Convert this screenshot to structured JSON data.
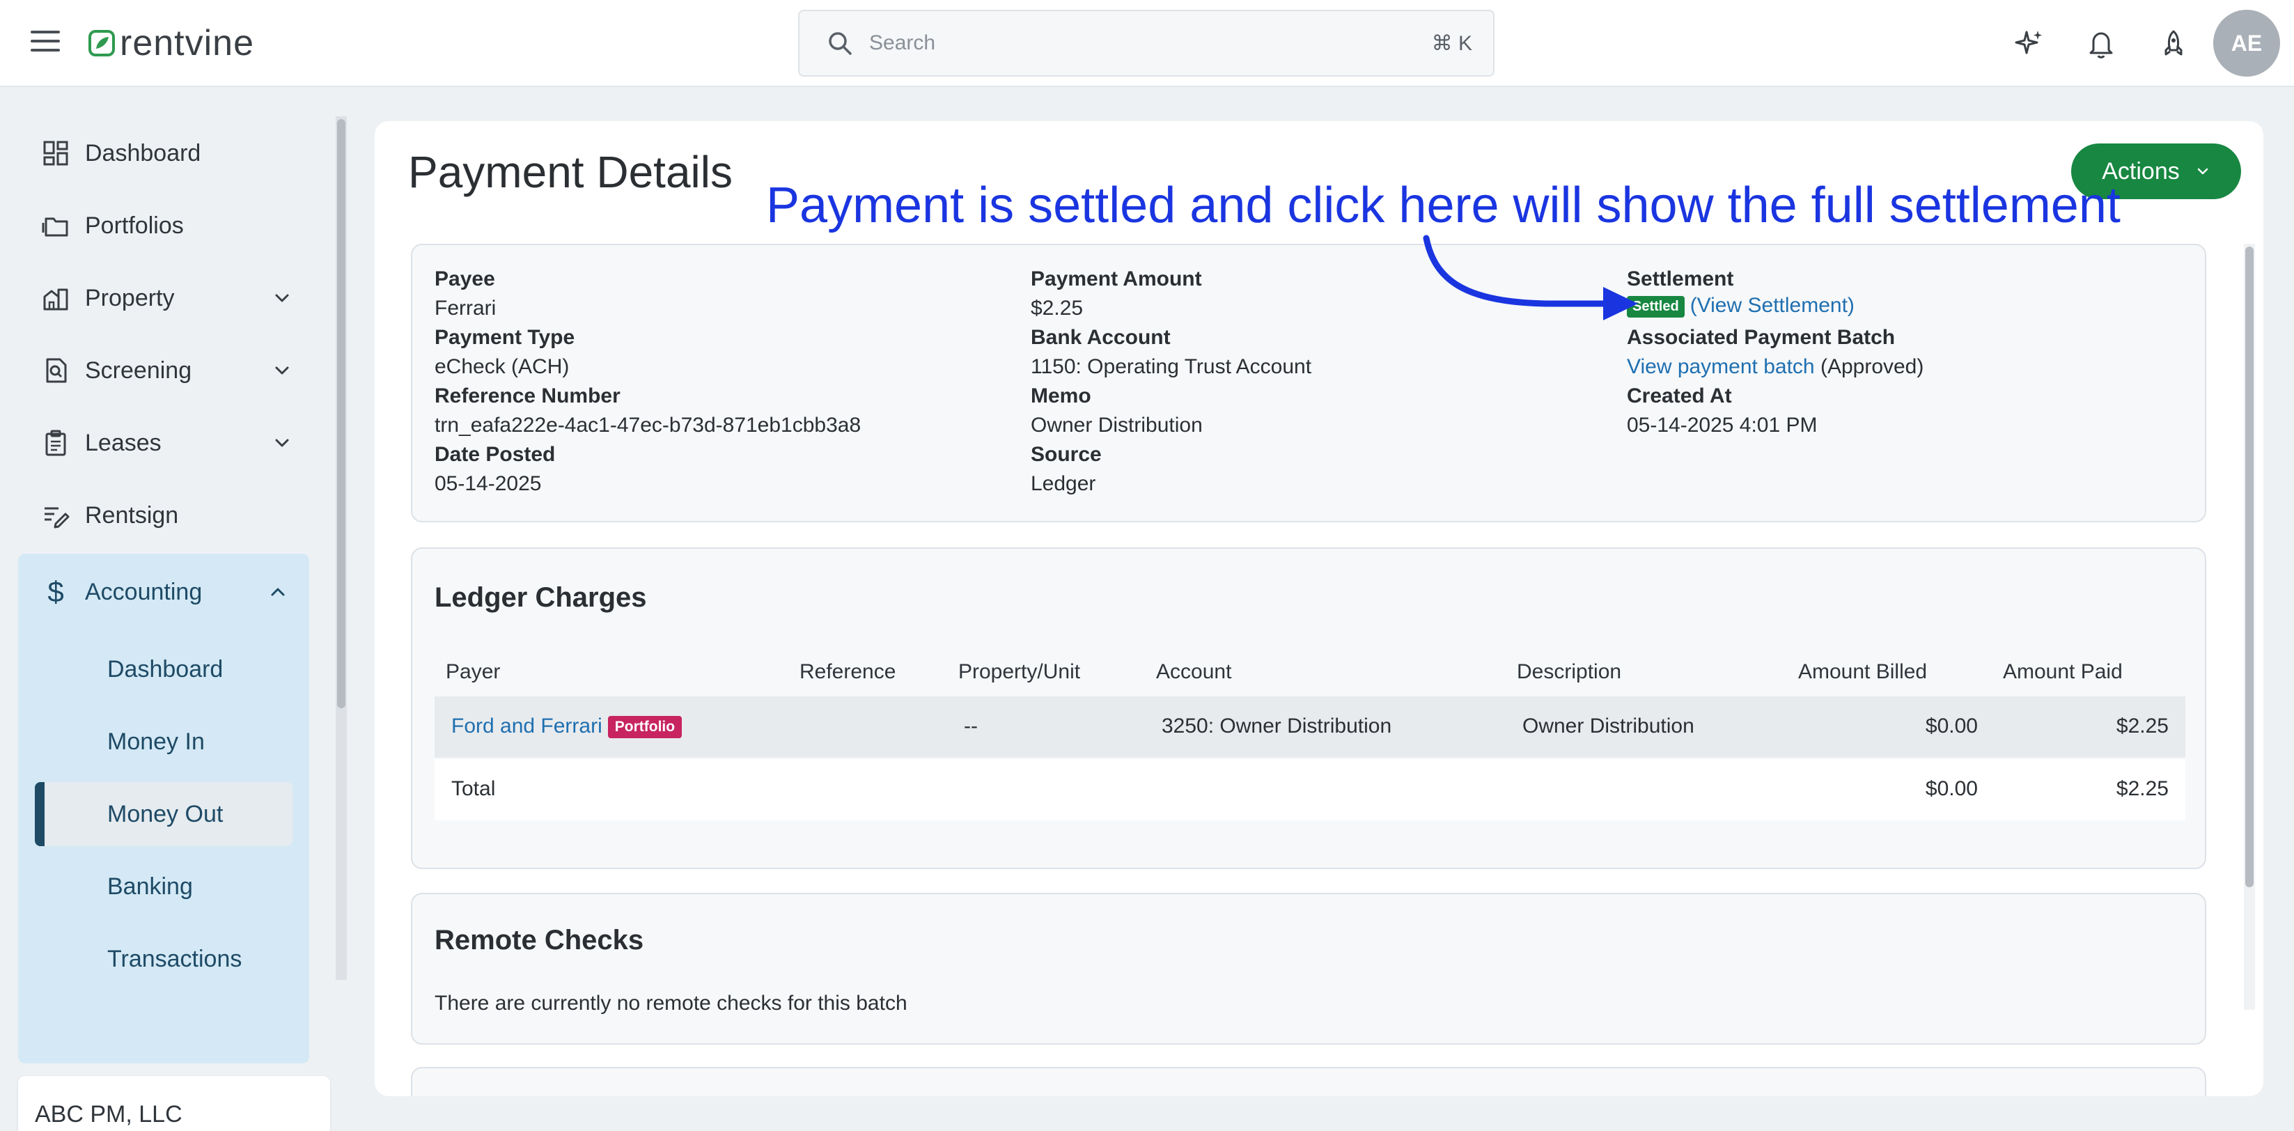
{
  "app": {
    "brand": "rentvine",
    "search_placeholder": "Search",
    "search_shortcut": "⌘ K",
    "avatar_initials": "AE",
    "accent_color": "#178741",
    "link_color": "#1f6fb0"
  },
  "sidebar": {
    "items": [
      {
        "label": "Dashboard",
        "icon": "dashboard-icon"
      },
      {
        "label": "Portfolios",
        "icon": "portfolios-icon"
      },
      {
        "label": "Property",
        "icon": "property-icon"
      },
      {
        "label": "Screening",
        "icon": "screening-icon"
      },
      {
        "label": "Leases",
        "icon": "leases-icon"
      },
      {
        "label": "Rentsign",
        "icon": "rentsign-icon"
      }
    ],
    "accounting": {
      "label": "Accounting",
      "children": [
        "Dashboard",
        "Money In",
        "Money Out",
        "Banking",
        "Transactions"
      ],
      "active": "Money Out"
    },
    "org_name": "ABC PM, LLC"
  },
  "page": {
    "title": "Payment Details",
    "actions_label": "Actions"
  },
  "details": {
    "payee_label": "Payee",
    "payee_value": "Ferrari",
    "payment_type_label": "Payment Type",
    "payment_type_value": "eCheck (ACH)",
    "reference_number_label": "Reference Number",
    "reference_number_value": "trn_eafa222e-4ac1-47ec-b73d-871eb1cbb3a8",
    "date_posted_label": "Date Posted",
    "date_posted_value": "05-14-2025",
    "payment_amount_label": "Payment Amount",
    "payment_amount_value": "$2.25",
    "bank_account_label": "Bank Account",
    "bank_account_value": "1150: Operating Trust Account",
    "memo_label": "Memo",
    "memo_value": "Owner Distribution",
    "source_label": "Source",
    "source_value": "Ledger",
    "settlement_label": "Settlement",
    "settlement_badge": "Settled",
    "settlement_link": "(View Settlement)",
    "batch_label": "Associated Payment Batch",
    "batch_link": "View payment batch",
    "batch_status": "(Approved)",
    "created_at_label": "Created At",
    "created_at_value": "05-14-2025 4:01 PM"
  },
  "ledger": {
    "title": "Ledger Charges",
    "columns": [
      "Payer",
      "Reference",
      "Property/Unit",
      "Account",
      "Description",
      "Amount Billed",
      "Amount Paid"
    ],
    "row": {
      "payer": "Ford and Ferrari",
      "payer_badge": "Portfolio",
      "reference": "",
      "property_unit": "--",
      "account": "3250: Owner Distribution",
      "description": "Owner Distribution",
      "amount_billed": "$0.00",
      "amount_paid": "$2.25"
    },
    "total": {
      "label": "Total",
      "amount_billed": "$0.00",
      "amount_paid": "$2.25"
    }
  },
  "remote_checks": {
    "title": "Remote Checks",
    "empty_message": "There are currently no remote checks for this batch"
  },
  "annotation": {
    "text": "Payment is settled and click here will show the full settlement",
    "color": "#1a35e0"
  }
}
